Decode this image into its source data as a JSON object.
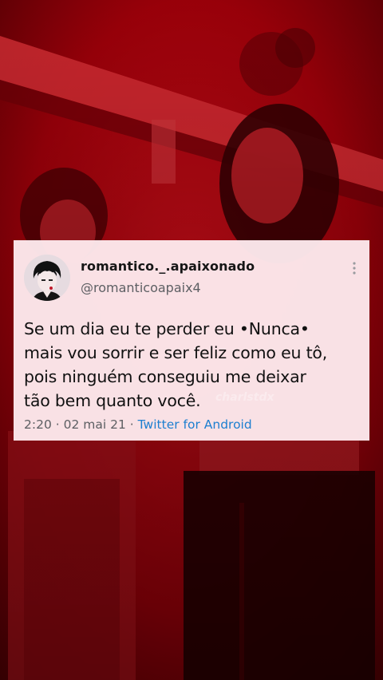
{
  "tweet": {
    "display_name": "romantico._.apaixonado",
    "handle": "@romanticoapaix4",
    "text": "Se um dia eu te perder eu •Nunca•\nmais vou sorrir e ser feliz como eu tô,\npois ninguém conseguiu me deixar\ntão bem quanto você.",
    "time": "2:20",
    "date": "02 mai 21",
    "separator": "·",
    "source": "Twitter for Android",
    "avatar_icon": "anime-boy-avatar",
    "more_icon": "more-vertical-icon"
  },
  "watermark": {
    "text": "charlstdx"
  },
  "colors": {
    "background_red": "#c4000f",
    "card": "#fde8ec",
    "link_blue": "#1d7fd0"
  }
}
